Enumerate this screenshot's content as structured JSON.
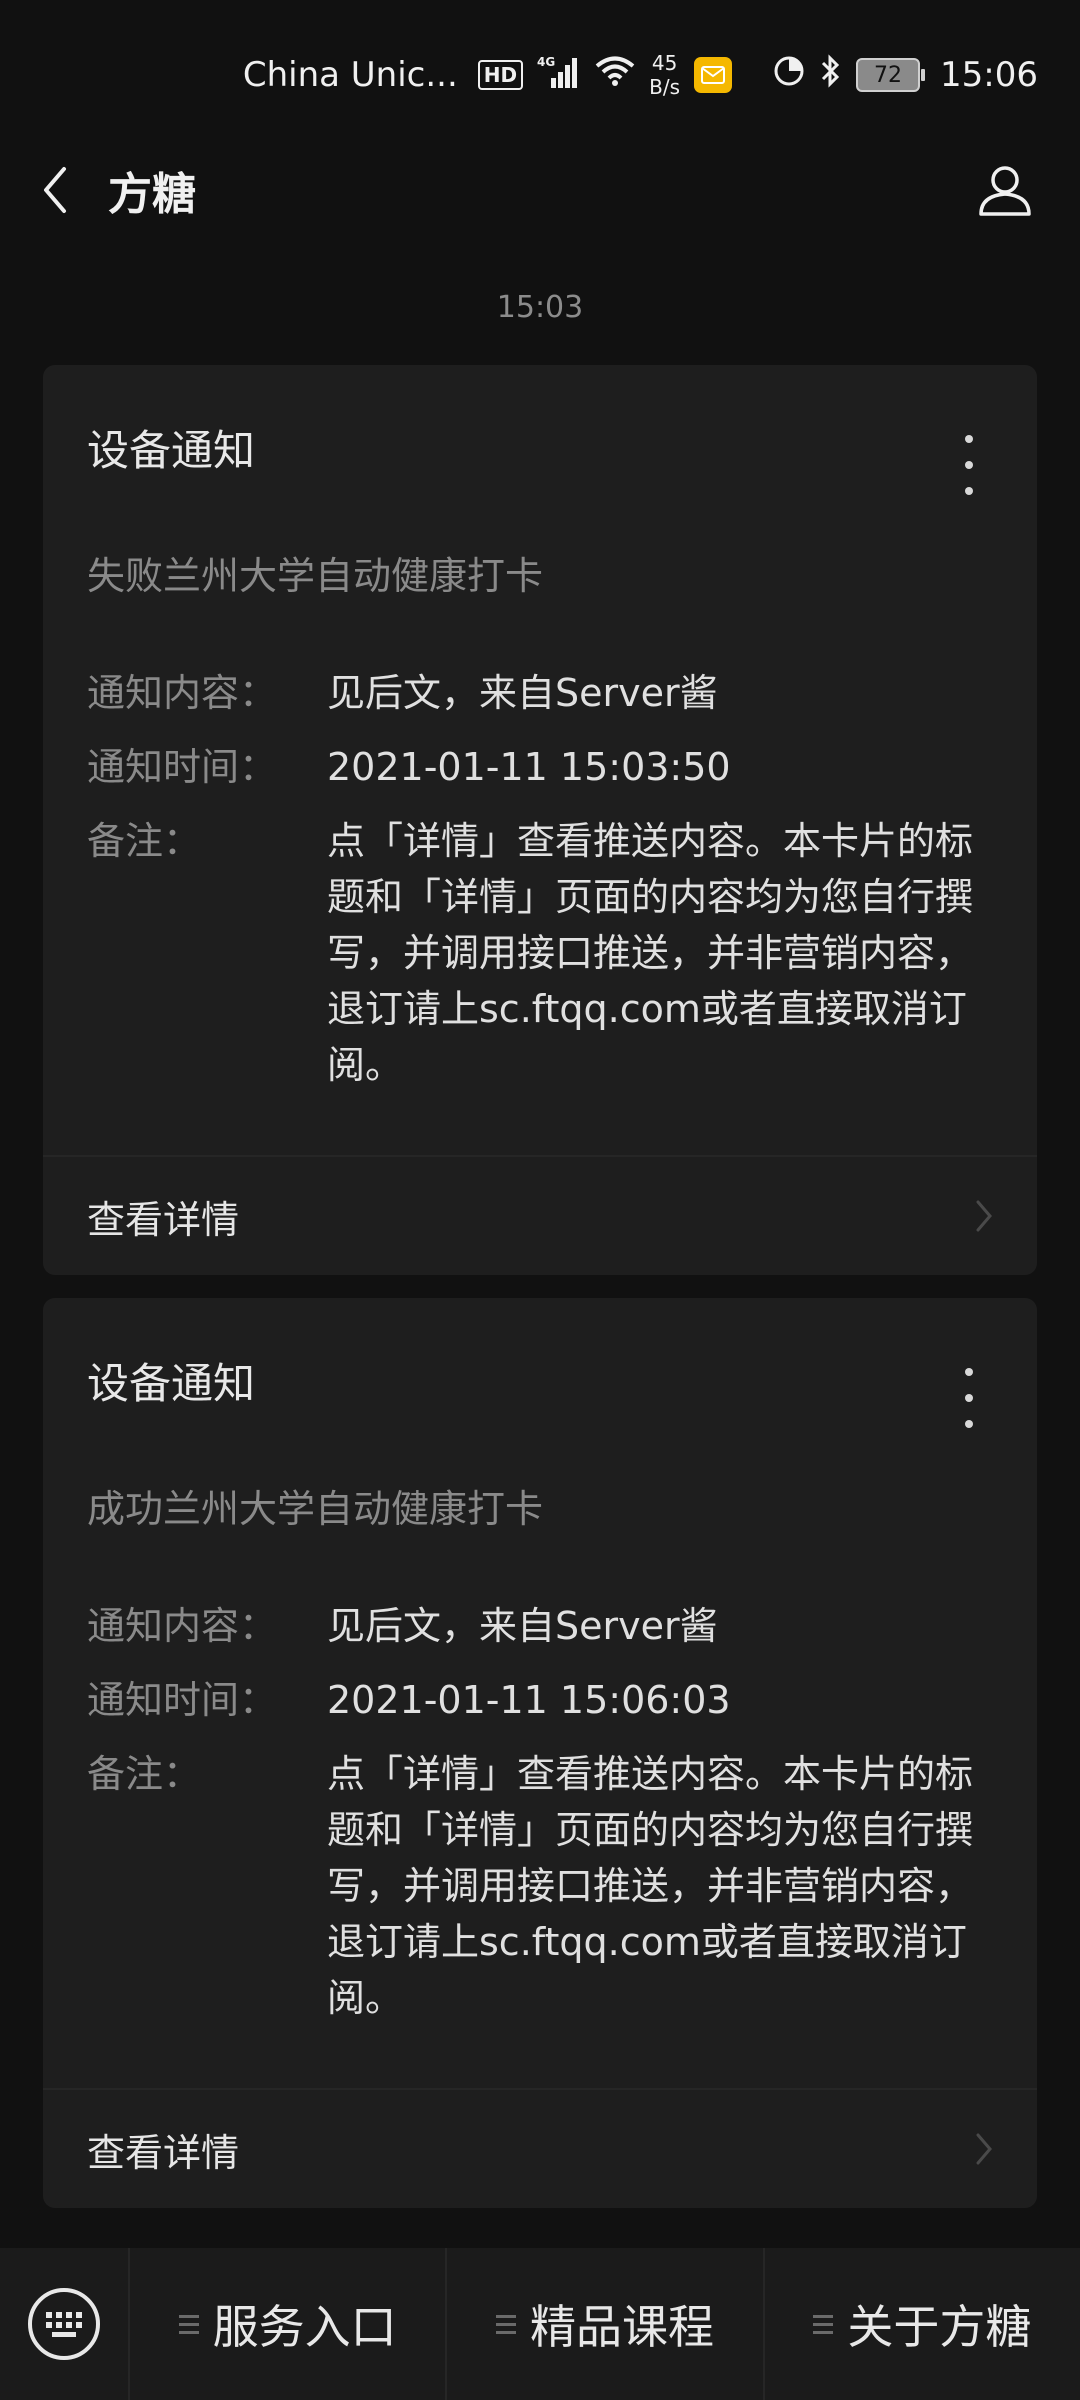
{
  "status_bar": {
    "carrier": "China Unic...",
    "hd_badge": "HD",
    "network": "4G",
    "speed_value": "45",
    "speed_unit": "B/s",
    "battery": "72",
    "time": "15:06"
  },
  "header": {
    "title": "方糖"
  },
  "timestamp": "15:03",
  "cards": [
    {
      "title": "设备通知",
      "subtitle": "失败兰州大学自动健康打卡",
      "content_label": "通知内容：",
      "content_value": "见后文，来自Server酱",
      "time_label": "通知时间：",
      "time_value": "2021-01-11 15:03:50",
      "note_label": "备注：",
      "note_value": "点「详情」查看推送内容。本卡片的标题和「详情」页面的内容均为您自行撰写，并调用接口推送，并非营销内容，退订请上sc.ftqq.com或者直接取消订阅。",
      "detail_label": "查看详情"
    },
    {
      "title": "设备通知",
      "subtitle": "成功兰州大学自动健康打卡",
      "content_label": "通知内容：",
      "content_value": "见后文，来自Server酱",
      "time_label": "通知时间：",
      "time_value": "2021-01-11 15:06:03",
      "note_label": "备注：",
      "note_value": "点「详情」查看推送内容。本卡片的标题和「详情」页面的内容均为您自行撰写，并调用接口推送，并非营销内容，退订请上sc.ftqq.com或者直接取消订阅。",
      "detail_label": "查看详情"
    }
  ],
  "bottom_menu": {
    "items": [
      "服务入口",
      "精品课程",
      "关于方糖"
    ]
  }
}
